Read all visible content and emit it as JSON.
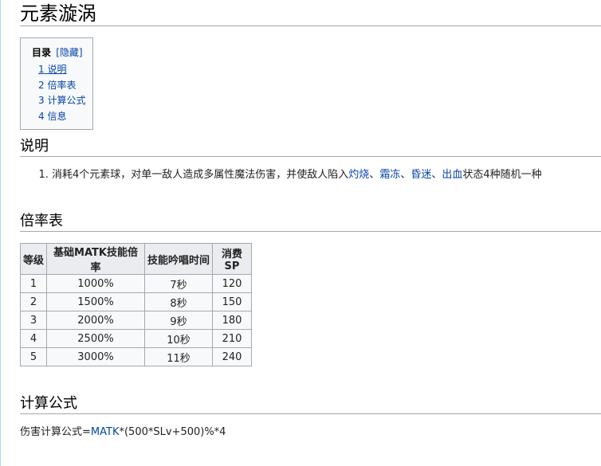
{
  "page": {
    "title": "元素漩涡"
  },
  "toc": {
    "title": "目录",
    "toggle": "[隐藏]",
    "items": [
      {
        "number": "1",
        "label": "说明"
      },
      {
        "number": "2",
        "label": "倍率表"
      },
      {
        "number": "3",
        "label": "计算公式"
      },
      {
        "number": "4",
        "label": "信息"
      }
    ]
  },
  "sections": {
    "description": {
      "heading": "说明",
      "item_text_before": "消耗4个元素球，对单一敌人造成多属性魔法伤害，并使敌人陷入",
      "status_links": [
        "灼烧",
        "霜冻",
        "昏迷",
        "出血"
      ],
      "separator": "、",
      "item_text_after": "状态4种随机一种"
    },
    "rates": {
      "heading": "倍率表",
      "columns": [
        "等级",
        "基础MATK技能倍率",
        "技能吟唱时间",
        "消费SP"
      ],
      "rows": [
        [
          "1",
          "1000%",
          "7秒",
          "120"
        ],
        [
          "2",
          "1500%",
          "8秒",
          "150"
        ],
        [
          "3",
          "2000%",
          "9秒",
          "180"
        ],
        [
          "4",
          "2500%",
          "10秒",
          "210"
        ],
        [
          "5",
          "3000%",
          "11秒",
          "240"
        ]
      ]
    },
    "formula": {
      "heading": "计算公式",
      "label": "伤害计算公式=",
      "link": "MATK",
      "expression": "*(500*SLv+500)%*4"
    }
  }
}
